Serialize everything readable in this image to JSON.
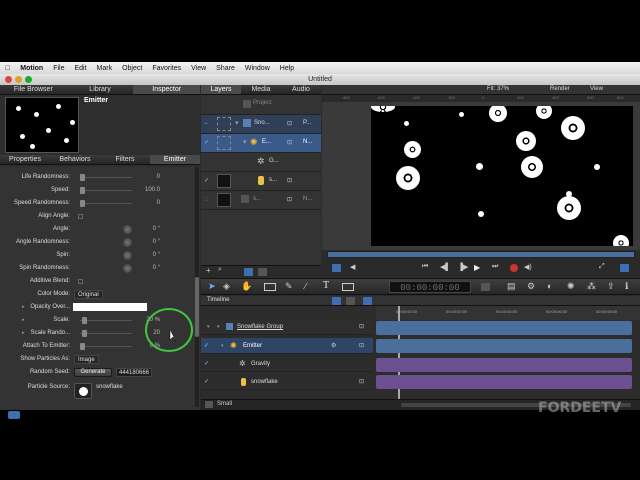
{
  "menubar": {
    "app": "Motion",
    "items": [
      "File",
      "Edit",
      "Mark",
      "Object",
      "Favorites",
      "View",
      "Share",
      "Window",
      "Help"
    ]
  },
  "window": {
    "title": "Untitled"
  },
  "left_tabs": [
    "File Browser",
    "Library",
    "Inspector"
  ],
  "preview": {
    "name": "Emitter"
  },
  "inspector_tabs": [
    "Properties",
    "Behaviors",
    "Filters",
    "Emitter"
  ],
  "params": [
    {
      "label": "Life Randomness:",
      "value": "0"
    },
    {
      "label": "Speed:",
      "value": "100.0"
    },
    {
      "label": "Speed Randomness:",
      "value": "0"
    },
    {
      "label": "Align Angle:",
      "value": ""
    },
    {
      "label": "Angle:",
      "value": "0 °"
    },
    {
      "label": "Angle Randomness:",
      "value": "0 °"
    },
    {
      "label": "Spin:",
      "value": "0 °"
    },
    {
      "label": "Spin Randomness:",
      "value": "0 °"
    },
    {
      "label": "Additive Blend:",
      "value": ""
    },
    {
      "label": "Color Mode:",
      "value": "Original"
    },
    {
      "label": "Opacity Over...",
      "value": ""
    },
    {
      "label": "Scale:",
      "value": "20 %"
    },
    {
      "label": "Scale Rando...",
      "value": "20"
    },
    {
      "label": "Attach To Emitter:",
      "value": "0 %"
    },
    {
      "label": "Show Particles As:",
      "value": "Image"
    },
    {
      "label": "Random Seed:",
      "value": "444180666"
    },
    {
      "label": "Particle Source:",
      "value": "snowflake"
    }
  ],
  "generate_label": "Generate",
  "middle_tabs": [
    "Layers",
    "Media",
    "Audio"
  ],
  "layers": [
    {
      "name": "Project",
      "value": ""
    },
    {
      "name": "Sno...",
      "value": "P..."
    },
    {
      "name": "E...",
      "value": "N..."
    },
    {
      "name": "G...",
      "value": ""
    },
    {
      "name": "s...",
      "value": ""
    },
    {
      "name": "s...",
      "value": "N..."
    }
  ],
  "canvas": {
    "fit_label": "Fit: 37%",
    "render_label": "Render",
    "view_label": "View",
    "ruler_ticks": [
      "-800",
      "-600",
      "-400",
      "-200",
      "0",
      "200",
      "400",
      "600",
      "800"
    ]
  },
  "timecode": "00:00:00:00",
  "timeline": {
    "title": "Timeline",
    "ticks": [
      "00:00:00:00",
      "00:00:02:00",
      "00:00:04:00",
      "00:00:06:00",
      "00:00:08:00"
    ],
    "tracks": [
      {
        "name": "Snowflake Group",
        "color": "#4a6f9c"
      },
      {
        "name": "Emitter",
        "color": "#4a6f9c"
      },
      {
        "name": "Gravity",
        "color": "#6b4f8f"
      },
      {
        "name": "snowflake",
        "color": "#6b4f8f"
      }
    ],
    "size_label": "Small"
  },
  "watermark": "FORDEETV"
}
